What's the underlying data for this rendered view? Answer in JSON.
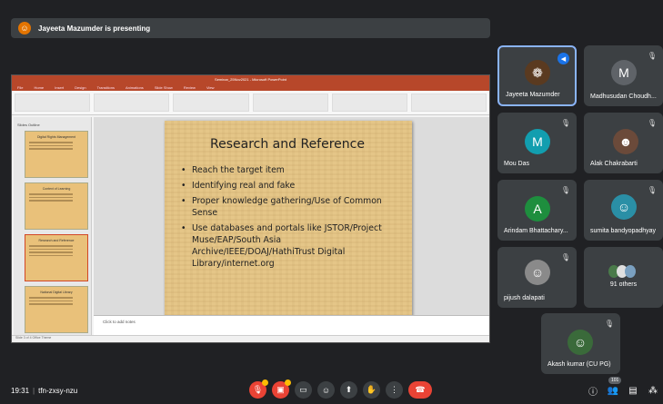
{
  "banner": {
    "text": "Jayeeta Mazumder is presenting"
  },
  "ppt": {
    "window_title": "Seminar_25Nov2021 - Microsoft PowerPoint",
    "tabs": [
      "File",
      "Home",
      "Insert",
      "Design",
      "Transitions",
      "Animations",
      "Slide Show",
      "Review",
      "View"
    ],
    "pane_tabs": "Slides   Outline",
    "thumbnails": [
      {
        "title": "Digital Rights Management"
      },
      {
        "title": "Context of Learning"
      },
      {
        "title": "Research and Reference"
      },
      {
        "title": "National Digital Library"
      }
    ],
    "notes_placeholder": "Click to add notes",
    "status": "Slide 3 of 4   Office Theme"
  },
  "slide": {
    "title": "Research and Reference",
    "bullets": [
      "Reach the target item",
      "Identifying real and fake",
      "Proper knowledge gathering/Use of Common Sense",
      "Use databases and portals like JSTOR/Project Muse/EAP/South Asia Archive/IEEE/DOAJ/HathiTrust Digital Library/internet.org"
    ]
  },
  "participants": [
    {
      "name": "Jayeeta Mazumder",
      "initial": "",
      "color": "#5a3a20"
    },
    {
      "name": "Madhusudan Choudh...",
      "initial": "M",
      "color": "#5f6368"
    },
    {
      "name": "Mou Das",
      "initial": "M",
      "color": "#129eaf"
    },
    {
      "name": "Alak Chakrabarti",
      "initial": "",
      "color": "#6b4a3a"
    },
    {
      "name": "Arindam Bhattachary...",
      "initial": "A",
      "color": "#1e8e3e"
    },
    {
      "name": "sumita bandyopadhyay",
      "initial": "",
      "color": "#2a8fa6"
    },
    {
      "name": "pijush dalapati",
      "initial": "",
      "color": "#8a8a8a"
    },
    {
      "name": "91 others",
      "initial": "",
      "color": "#4a4a4a"
    },
    {
      "name": "Akash kumar (CU PG)",
      "initial": "",
      "color": "#3a6a3a"
    }
  ],
  "bottom": {
    "time": "19:31",
    "meeting_code": "tfn-zxsy-nzu",
    "people_count": "101"
  },
  "icons": {
    "mic_off": "mic-off-icon",
    "cam_off": "camera-off-icon",
    "captions": "captions-icon",
    "emoji": "emoji-icon",
    "present": "present-icon",
    "raise_hand": "raise-hand-icon",
    "more": "more-options-icon",
    "hangup": "hangup-icon"
  }
}
